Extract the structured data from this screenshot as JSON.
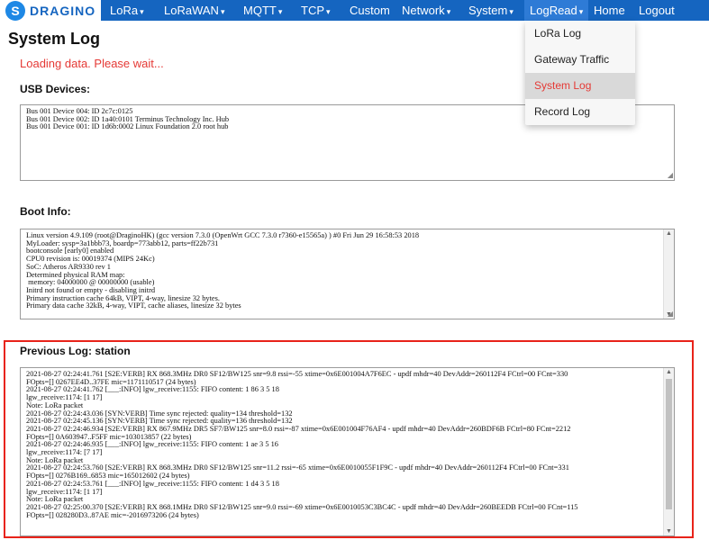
{
  "brand": {
    "logo_text": "DRAGINO",
    "accent": "#1565c0"
  },
  "nav": [
    {
      "label": "LoRa",
      "caret": "▾"
    },
    {
      "label": "LoRaWAN",
      "caret": "▾"
    },
    {
      "label": "MQTT",
      "caret": "▾"
    },
    {
      "label": "TCP",
      "caret": "▾"
    },
    {
      "label": "Custom",
      "caret": ""
    },
    {
      "label": "Network",
      "caret": "▾"
    },
    {
      "label": "System",
      "caret": "▾"
    },
    {
      "label": "LogRead",
      "caret": "▾"
    },
    {
      "label": "Home",
      "caret": ""
    },
    {
      "label": "Logout",
      "caret": ""
    }
  ],
  "dropdown": {
    "items": [
      "LoRa Log",
      "Gateway Traffic",
      "System Log",
      "Record Log"
    ],
    "active": "System Log"
  },
  "page": {
    "title": "System Log",
    "loading": "Loading data. Please wait..."
  },
  "usb": {
    "title": "USB Devices:",
    "text": "Bus 001 Device 004: ID 2c7c:0125\nBus 001 Device 002: ID 1a40:0101 Terminus Technology Inc. Hub\nBus 001 Device 001: ID 1d6b:0002 Linux Foundation 2.0 root hub"
  },
  "boot": {
    "title": "Boot Info:",
    "text": "Linux version 4.9.109 (root@DraginoHK) (gcc version 7.3.0 (OpenWrt GCC 7.3.0 r7360-e15565a) ) #0 Fri Jun 29 16:58:53 2018\nMyLoader: sysp=3a1bbb73, boardp=773abb12, parts=ff22b731\nbootconsole [early0] enabled\nCPU0 revision is: 00019374 (MIPS 24Kc)\nSoC: Atheros AR9330 rev 1\nDetermined physical RAM map:\n memory: 04000000 @ 00000000 (usable)\nInitrd not found or empty - disabling initrd\nPrimary instruction cache 64kB, VIPT, 4-way, linesize 32 bytes.\nPrimary data cache 32kB, 4-way, VIPT, cache aliases, linesize 32 bytes"
  },
  "previous": {
    "title": "Previous Log: station",
    "text": "2021-08-27 02:24:41.761 [S2E:VERB] RX 868.3MHz DR0 SF12/BW125 snr=9.8 rssi=-55 xtime=0x6E001004A7F6EC - updf mhdr=40 DevAddr=260112F4 FCtrl=00 FCnt=330\nFOpts=[] 0267EE4D..37FE mic=1171110517 (24 bytes)\n2021-08-27 02:24:41.762 [___:INFO] lgw_receive:1155: FIFO content: 1 86 3 5 18\nlgw_receive:1174: [1 17]\nNote: LoRa packet\n2021-08-27 02:24:43.036 [SYN:VERB] Time sync rejected: quality=134 threshold=132\n2021-08-27 02:24:45.136 [SYN:VERB] Time sync rejected: quality=136 threshold=132\n2021-08-27 02:24:46.934 [S2E:VERB] RX 867.9MHz DR5 SF7/BW125 snr=8.0 rssi=-87 xtime=0x6E001004F76AF4 - updf mhdr=40 DevAddr=260BDF6B FCtrl=80 FCnt=2212\nFOpts=[] 0A603947..F5FF mic=103013857 (22 bytes)\n2021-08-27 02:24:46.935 [___:INFO] lgw_receive:1155: FIFO content: 1 ae 3 5 16\nlgw_receive:1174: [7 17]\nNote: LoRa packet\n2021-08-27 02:24:53.760 [S2E:VERB] RX 868.3MHz DR0 SF12/BW125 snr=11.2 rssi=-65 xtime=0x6E0010055F1F9C - updf mhdr=40 DevAddr=260112F4 FCtrl=00 FCnt=331\nFOpts=[] 0276B169..6853 mic=165012602 (24 bytes)\n2021-08-27 02:24:53.761 [___:INFO] lgw_receive:1155: FIFO content: 1 d4 3 5 18\nlgw_receive:1174: [1 17]\nNote: LoRa packet\n2021-08-27 02:25:00.370 [S2E:VERB] RX 868.1MHz DR0 SF12/BW125 snr=9.0 rssi=-69 xtime=0x6E0010053C3BC4C - updf mhdr=40 DevAddr=260BEEDB FCtrl=00 FCnt=115\nFOpts=[] 028280D3..87AE mic=-2016973206 (24 bytes)"
  }
}
